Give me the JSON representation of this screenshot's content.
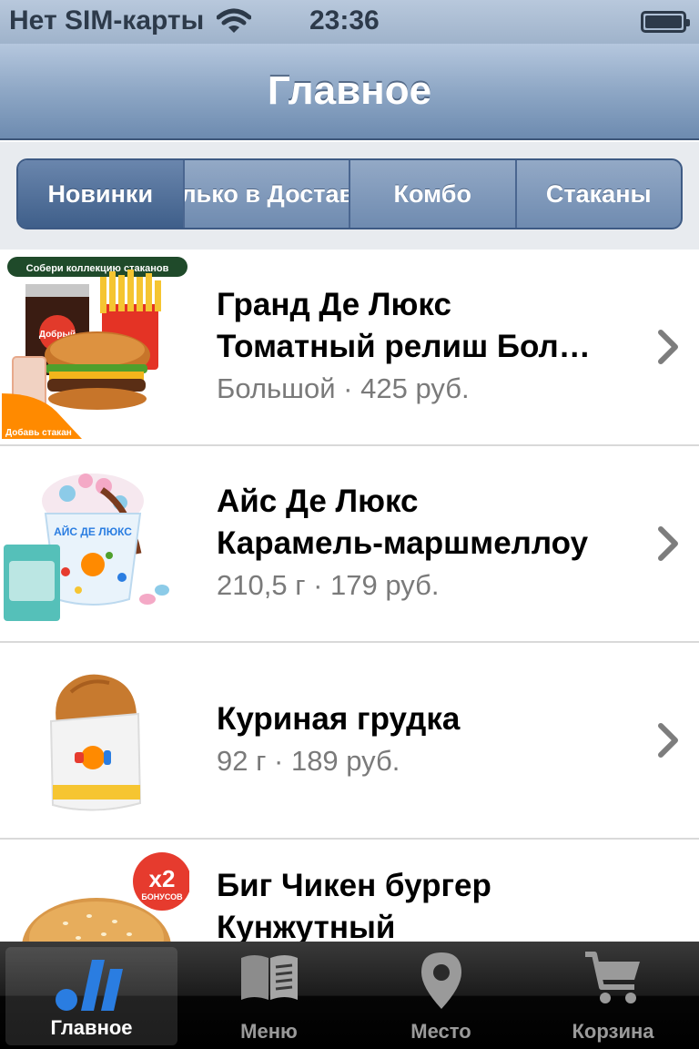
{
  "status_bar": {
    "carrier": "Нет SIM-карты",
    "time": "23:36"
  },
  "nav": {
    "title": "Главное"
  },
  "segments": [
    {
      "label": "Новинки",
      "active": true
    },
    {
      "label": "Только в Доставке",
      "active": false
    },
    {
      "label": "Комбо",
      "active": false
    },
    {
      "label": "Стаканы",
      "active": false
    }
  ],
  "products": [
    {
      "name_line1": "Гранд Де Люкс",
      "name_line2": "Томатный релиш Бол…",
      "detail": "Большой · 425 руб.",
      "badge_top": "Собери коллекцию стаканов",
      "badge_bottom": "Добавь стакан",
      "cup_text": "Добрый"
    },
    {
      "name_line1": "Айс Де Люкс",
      "name_line2": "Карамель-маршмеллоу",
      "detail": "210,5 г · 179 руб.",
      "cup_text": "АЙС ДЕ ЛЮКС"
    },
    {
      "name_line1": "Куриная грудка",
      "detail": "92 г · 189 руб."
    },
    {
      "name_line1": "Биг Чикен бургер",
      "name_line2": "Кунжутный",
      "badge_main": "x2",
      "badge_sub": "БОНУСОВ"
    }
  ],
  "tabs": [
    {
      "label": "Главное",
      "icon": "brand-logo-icon",
      "active": true
    },
    {
      "label": "Меню",
      "icon": "book-icon",
      "active": false
    },
    {
      "label": "Место",
      "icon": "location-pin-icon",
      "active": false
    },
    {
      "label": "Корзина",
      "icon": "cart-icon",
      "active": false
    }
  ],
  "colors": {
    "nav_blue": "#6d8bb0",
    "brand_orange": "#ff8a00",
    "brand_red": "#e63b2e",
    "brand_blue": "#2a7de1"
  }
}
